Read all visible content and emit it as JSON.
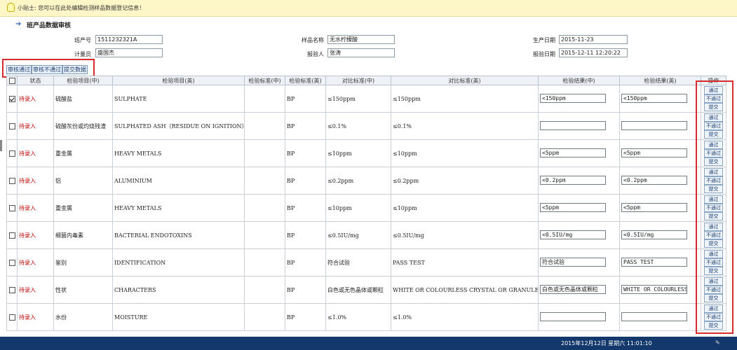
{
  "tip": {
    "text": "小贴士: 您可以在此处编辑检测样品数据登记信息！"
  },
  "page_title": "班产品数据审核",
  "form": {
    "batch_no_label": "班产号",
    "batch_no": "1511232321A",
    "sample_name_label": "样品名称",
    "sample_name": "无水柠檬酸",
    "prod_date_label": "生产日期",
    "prod_date": "2015-11-23",
    "metering_label": "计量员",
    "metering": "盛国杰",
    "reporter_label": "报验人",
    "reporter": "张涛",
    "report_date_label": "报验日期",
    "report_date": "2015-12-11 12:20:22"
  },
  "toolbar": {
    "approve": "审核通过",
    "reject": "审核不通过",
    "submit": "提交数据"
  },
  "columns": [
    "",
    "状态",
    "检验项目(中)",
    "检验项目(英)",
    "检验标准(中)",
    "检验标准(英)",
    "对比标准(中)",
    "对比标准(英)",
    "检验结果(中)",
    "检验结果(英)",
    "操作"
  ],
  "rows": [
    {
      "checked": true,
      "status": "待录入",
      "item_cn": "硫酸盐",
      "item_en": "SULPHATE",
      "std_cn": "",
      "std_en": "BP",
      "cmp_cn": "≤150ppm",
      "cmp_en": "≤150ppm",
      "res_cn": "<150ppm",
      "res_en": "<150ppm"
    },
    {
      "checked": false,
      "status": "待录入",
      "item_cn": "硫酸灰份或灼烧残渣",
      "item_en": "SULPHATED ASH（RESIDUE ON IGNITION）",
      "std_cn": "",
      "std_en": "BP",
      "cmp_cn": "≤0.1%",
      "cmp_en": "≤0.1%",
      "res_cn": "",
      "res_en": ""
    },
    {
      "checked": false,
      "status": "待录入",
      "item_cn": "重金属",
      "item_en": "HEAVY METALS",
      "std_cn": "",
      "std_en": "BP",
      "cmp_cn": "≤10ppm",
      "cmp_en": "≤10ppm",
      "res_cn": "<5ppm",
      "res_en": "<5ppm"
    },
    {
      "checked": false,
      "status": "待录入",
      "item_cn": "铝",
      "item_en": "ALUMINIUM",
      "std_cn": "",
      "std_en": "BP",
      "cmp_cn": "≤0.2ppm",
      "cmp_en": "≤0.2ppm",
      "res_cn": "<0.2ppm",
      "res_en": "<0.2ppm"
    },
    {
      "checked": false,
      "status": "待录入",
      "item_cn": "重金属",
      "item_en": "HEAVY METALS",
      "std_cn": "",
      "std_en": "BP",
      "cmp_cn": "≤10ppm",
      "cmp_en": "≤10ppm",
      "res_cn": "<5ppm",
      "res_en": "<5ppm"
    },
    {
      "checked": false,
      "status": "待录入",
      "item_cn": "细菌内毒素",
      "item_en": "BACTERIAL ENDOTOXINS",
      "std_cn": "",
      "std_en": "BP",
      "cmp_cn": "≤0.5IU/mg",
      "cmp_en": "≤0.5IU/mg",
      "res_cn": "<0.5IU/mg",
      "res_en": "<0.5IU/mg"
    },
    {
      "checked": false,
      "status": "待录入",
      "item_cn": "鉴别",
      "item_en": "IDENTIFICATION",
      "std_cn": "",
      "std_en": "BP",
      "cmp_cn": "符合试验",
      "cmp_en": "PASS TEST",
      "res_cn": "符合试验",
      "res_en": "PASS TEST"
    },
    {
      "checked": false,
      "status": "待录入",
      "item_cn": "性状",
      "item_en": "CHARACTERS",
      "std_cn": "",
      "std_en": "BP",
      "cmp_cn": "白色或无色晶体或颗粒",
      "cmp_en": "WHITE OR COLOURLESS CRYSTAL OR GRANULES",
      "res_cn": "白色或无色晶体或颗粒",
      "res_en": "WHITE  OR COLOURLESS"
    },
    {
      "checked": false,
      "status": "待录入",
      "item_cn": "水份",
      "item_en": "MOISTURE",
      "std_cn": "",
      "std_en": "BP",
      "cmp_cn": "≤1.0%",
      "cmp_en": "≤1.0%",
      "res_cn": "",
      "res_en": ""
    }
  ],
  "row_ops": {
    "pass": "通过",
    "fail": "不通过",
    "submit": "提交"
  },
  "statusbar": {
    "datetime": "2015年12月12日  星期六  11:01:10"
  }
}
